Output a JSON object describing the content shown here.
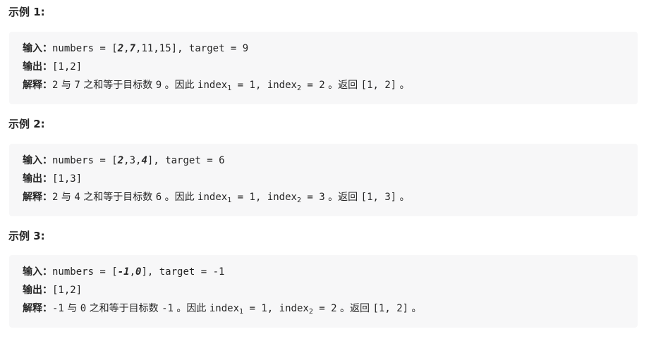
{
  "labels": {
    "input": "输入：",
    "output": "输出：",
    "explanation": "解释：",
    "numbers_eq": "numbers = [",
    "comma": ",",
    "close_bracket": "]",
    "target_eq": ", target = ",
    "yu": " 与 ",
    "sum_equals": " 之和等于目标数 ",
    "therefore": " 。因此 ",
    "index_word": "index",
    "sub1": "1",
    "sub2": "2",
    "eq": " = ",
    "sep": ", ",
    "return_word": " 。返回 ",
    "end_period": " 。"
  },
  "examples": [
    {
      "heading": "示例 1:",
      "numbers": [
        "2",
        "7",
        "11",
        "15"
      ],
      "target": "9",
      "output": "[1,2]",
      "exp_a": "2",
      "exp_b": "7",
      "exp_target": "9",
      "idx1": "1",
      "idx2": "2",
      "ret": "[1, 2]"
    },
    {
      "heading": "示例 2:",
      "numbers": [
        "2",
        "3",
        "4"
      ],
      "target": "6",
      "output": "[1,3]",
      "exp_a": "2",
      "exp_b": "4",
      "exp_target": "6",
      "idx1": "1",
      "idx2": "3",
      "ret": "[1, 3]"
    },
    {
      "heading": "示例 3:",
      "numbers": [
        "-1",
        "0"
      ],
      "target": "-1",
      "output": "[1,2]",
      "exp_a": "-1",
      "exp_b": "0",
      "exp_target": "-1",
      "idx1": "1",
      "idx2": "2",
      "ret": "[1, 2]"
    }
  ]
}
